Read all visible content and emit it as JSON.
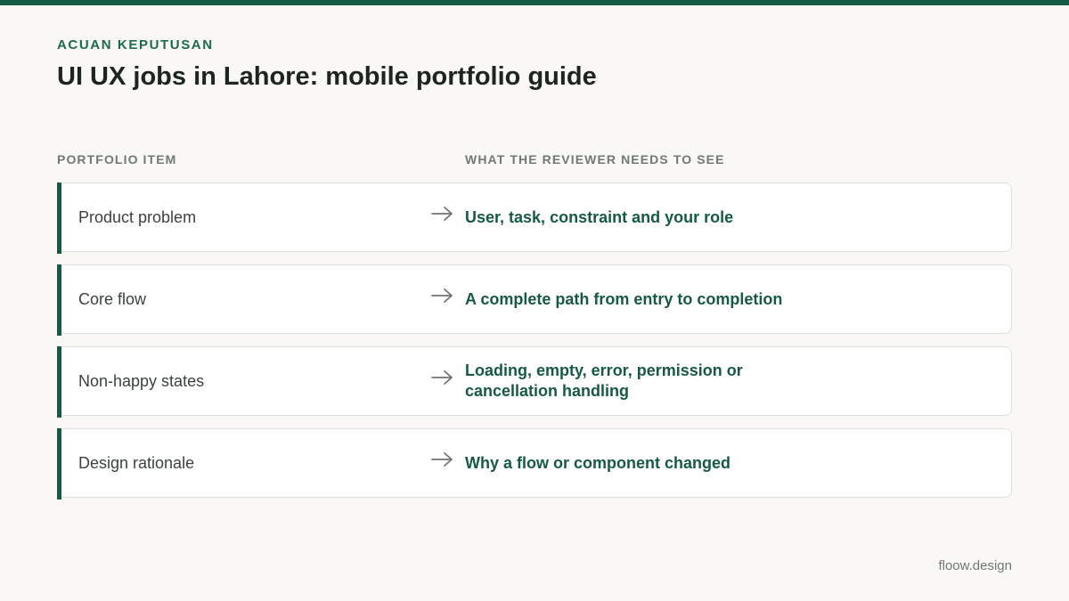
{
  "header": {
    "eyebrow": "ACUAN KEPUTUSAN",
    "title": "UI UX jobs in Lahore: mobile portfolio guide"
  },
  "table": {
    "columns": {
      "left": "PORTFOLIO ITEM",
      "right": "WHAT THE REVIEWER NEEDS TO SEE"
    },
    "rows": [
      {
        "item": "Product problem",
        "need": "User, task, constraint and your role"
      },
      {
        "item": "Core flow",
        "need": "A complete path from entry to completion"
      },
      {
        "item": "Non-happy states",
        "need": "Loading, empty, error, permission or cancellation handling"
      },
      {
        "item": "Design rationale",
        "need": "Why a flow or component changed"
      }
    ],
    "arrow_icon": "arrow-right-icon"
  },
  "footer": {
    "brand": "floow.design"
  },
  "colors": {
    "accent": "#165a45",
    "background": "#f9f8f5"
  }
}
